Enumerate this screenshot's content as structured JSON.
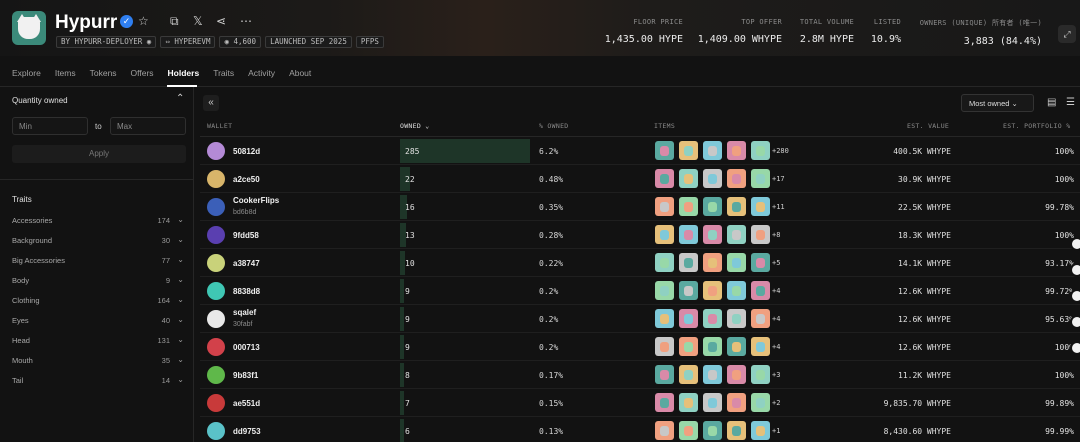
{
  "collection": {
    "title": "Hypurr",
    "badges": [
      "BY HYPURR-DEPLOYER ◉",
      "⇔ HYPEREVM",
      "◉ 4,600",
      "LAUNCHED SEP 2025",
      "PFPS"
    ]
  },
  "stats": [
    {
      "label": "FLOOR PRICE",
      "value": "1,435.00 HYPE"
    },
    {
      "label": "TOP OFFER",
      "value": "1,409.00 WHYPE"
    },
    {
      "label": "TOTAL VOLUME",
      "value": "2.8M HYPE"
    },
    {
      "label": "LISTED",
      "value": "10.9%"
    },
    {
      "label": "OWNERS (UNIQUE)",
      "value": "3,883 (84.4%)"
    },
    {
      "label": "所有者 (唯一)",
      "value": ""
    }
  ],
  "tabs": [
    "Explore",
    "Items",
    "Tokens",
    "Offers",
    "Holders",
    "Traits",
    "Activity",
    "About"
  ],
  "active_tab": "Holders",
  "sidebar": {
    "quantity_title": "Quantity owned",
    "min_placeholder": "Min",
    "to_label": "to",
    "max_placeholder": "Max",
    "apply_label": "Apply",
    "traits_title": "Traits",
    "traits": [
      {
        "name": "Accessories",
        "count": "174"
      },
      {
        "name": "Background",
        "count": "30"
      },
      {
        "name": "Big Accessories",
        "count": "77"
      },
      {
        "name": "Body",
        "count": "9"
      },
      {
        "name": "Clothing",
        "count": "164"
      },
      {
        "name": "Eyes",
        "count": "40"
      },
      {
        "name": "Head",
        "count": "131"
      },
      {
        "name": "Mouth",
        "count": "35"
      },
      {
        "name": "Tail",
        "count": "14"
      }
    ]
  },
  "toolbar": {
    "collapse_icon": "«",
    "sort_label": "Most owned ⌄"
  },
  "table": {
    "headers": {
      "wallet": "WALLET",
      "owned": "OWNED ⌄",
      "pct_owned": "% OWNED",
      "items": "ITEMS",
      "est_value": "EST. VALUE",
      "est_portfolio": "EST. PORTFOLIO %"
    },
    "rows": [
      {
        "wallet": "50812d",
        "sub": "",
        "owned": "285",
        "owned_share": 1.0,
        "pct": "6.2%",
        "more": "+280",
        "est": "400.5K WHYPE",
        "port": "100%",
        "avatar": "#b48ad6"
      },
      {
        "wallet": "a2ce50",
        "sub": "",
        "owned": "22",
        "owned_share": 0.08,
        "pct": "0.48%",
        "more": "+17",
        "est": "30.9K WHYPE",
        "port": "100%",
        "avatar": "#d8b56a"
      },
      {
        "wallet": "CookerFlips",
        "sub": "bd6b8d",
        "owned": "16",
        "owned_share": 0.056,
        "pct": "0.35%",
        "more": "+11",
        "est": "22.5K WHYPE",
        "port": "99.78%",
        "avatar": "#3b5fb8"
      },
      {
        "wallet": "9fdd58",
        "sub": "",
        "owned": "13",
        "owned_share": 0.046,
        "pct": "0.28%",
        "more": "+8",
        "est": "18.3K WHYPE",
        "port": "100%",
        "avatar": "#5a3fb0"
      },
      {
        "wallet": "a38747",
        "sub": "",
        "owned": "10",
        "owned_share": 0.035,
        "pct": "0.22%",
        "more": "+5",
        "est": "14.1K WHYPE",
        "port": "93.17%",
        "avatar": "#c9d27a"
      },
      {
        "wallet": "8838d8",
        "sub": "",
        "owned": "9",
        "owned_share": 0.032,
        "pct": "0.2%",
        "more": "+4",
        "est": "12.6K WHYPE",
        "port": "99.72%",
        "avatar": "#3fc7b4"
      },
      {
        "wallet": "sqalef",
        "sub": "30fabf",
        "owned": "9",
        "owned_share": 0.032,
        "pct": "0.2%",
        "more": "+4",
        "est": "12.6K WHYPE",
        "port": "95.63%",
        "avatar": "#e8e8e8"
      },
      {
        "wallet": "000713",
        "sub": "",
        "owned": "9",
        "owned_share": 0.032,
        "pct": "0.2%",
        "more": "+4",
        "est": "12.6K WHYPE",
        "port": "100%",
        "avatar": "#d2414a"
      },
      {
        "wallet": "9b83f1",
        "sub": "",
        "owned": "8",
        "owned_share": 0.028,
        "pct": "0.17%",
        "more": "+3",
        "est": "11.2K WHYPE",
        "port": "100%",
        "avatar": "#5fb84a"
      },
      {
        "wallet": "ae551d",
        "sub": "",
        "owned": "7",
        "owned_share": 0.025,
        "pct": "0.15%",
        "more": "+2",
        "est": "9,835.70 WHYPE",
        "port": "99.89%",
        "avatar": "#c83a3a"
      },
      {
        "wallet": "dd9753",
        "sub": "",
        "owned": "6",
        "owned_share": 0.021,
        "pct": "0.13%",
        "more": "+1",
        "est": "8,430.60 WHYPE",
        "port": "99.99%",
        "avatar": "#5ac2c8"
      }
    ],
    "thumb_colors": [
      "#5aa9a0",
      "#e6c07a",
      "#7fc9d9",
      "#d98aa8",
      "#8fd1c2",
      "#c8c8c8",
      "#f0a080",
      "#98d8a8"
    ]
  }
}
